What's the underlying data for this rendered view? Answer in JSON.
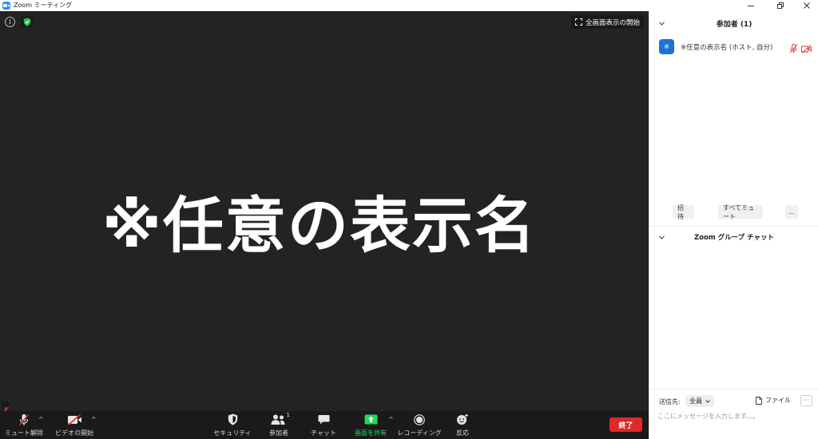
{
  "window": {
    "title": "Zoom ミーティング",
    "controls": [
      "minimize",
      "restore",
      "close"
    ]
  },
  "video": {
    "display_name": "※任意の表示名",
    "fullscreen_label": "全画面表示の開始",
    "icons": [
      "info-icon",
      "encryption-shield-icon",
      "fullscreen-icon"
    ]
  },
  "toolbar": {
    "unmute_label": "ミュート解除",
    "start_video_label": "ビデオの開始",
    "security_label": "セキュリティ",
    "participants_label": "参加者",
    "participants_count": "1",
    "chat_label": "チャット",
    "share_label": "画面を共有",
    "record_label": "レコーディング",
    "reactions_label": "反応",
    "end_label": "終了",
    "colors": {
      "share_accent": "#23d959",
      "end_button": "#e02828",
      "background": "#1a1a1a"
    }
  },
  "panel": {
    "participants_header": "参加者 (1)",
    "participant": {
      "avatar_text": "※",
      "name": "※任意の表示名 (ホスト, 自分)",
      "mic_state": "muted",
      "video_state": "off"
    },
    "invite_label": "招待",
    "mute_all_label": "すべてミュート",
    "more_label": "...",
    "chat_header": "Zoom グループ チャット",
    "send_to_label": "送信先:",
    "send_to_value": "全員",
    "file_label": "ファイル",
    "chat_placeholder": "ここにメッセージを入力します。。。",
    "colors": {
      "avatar": "#1a73d9",
      "muted_icon": "#e02828"
    }
  }
}
